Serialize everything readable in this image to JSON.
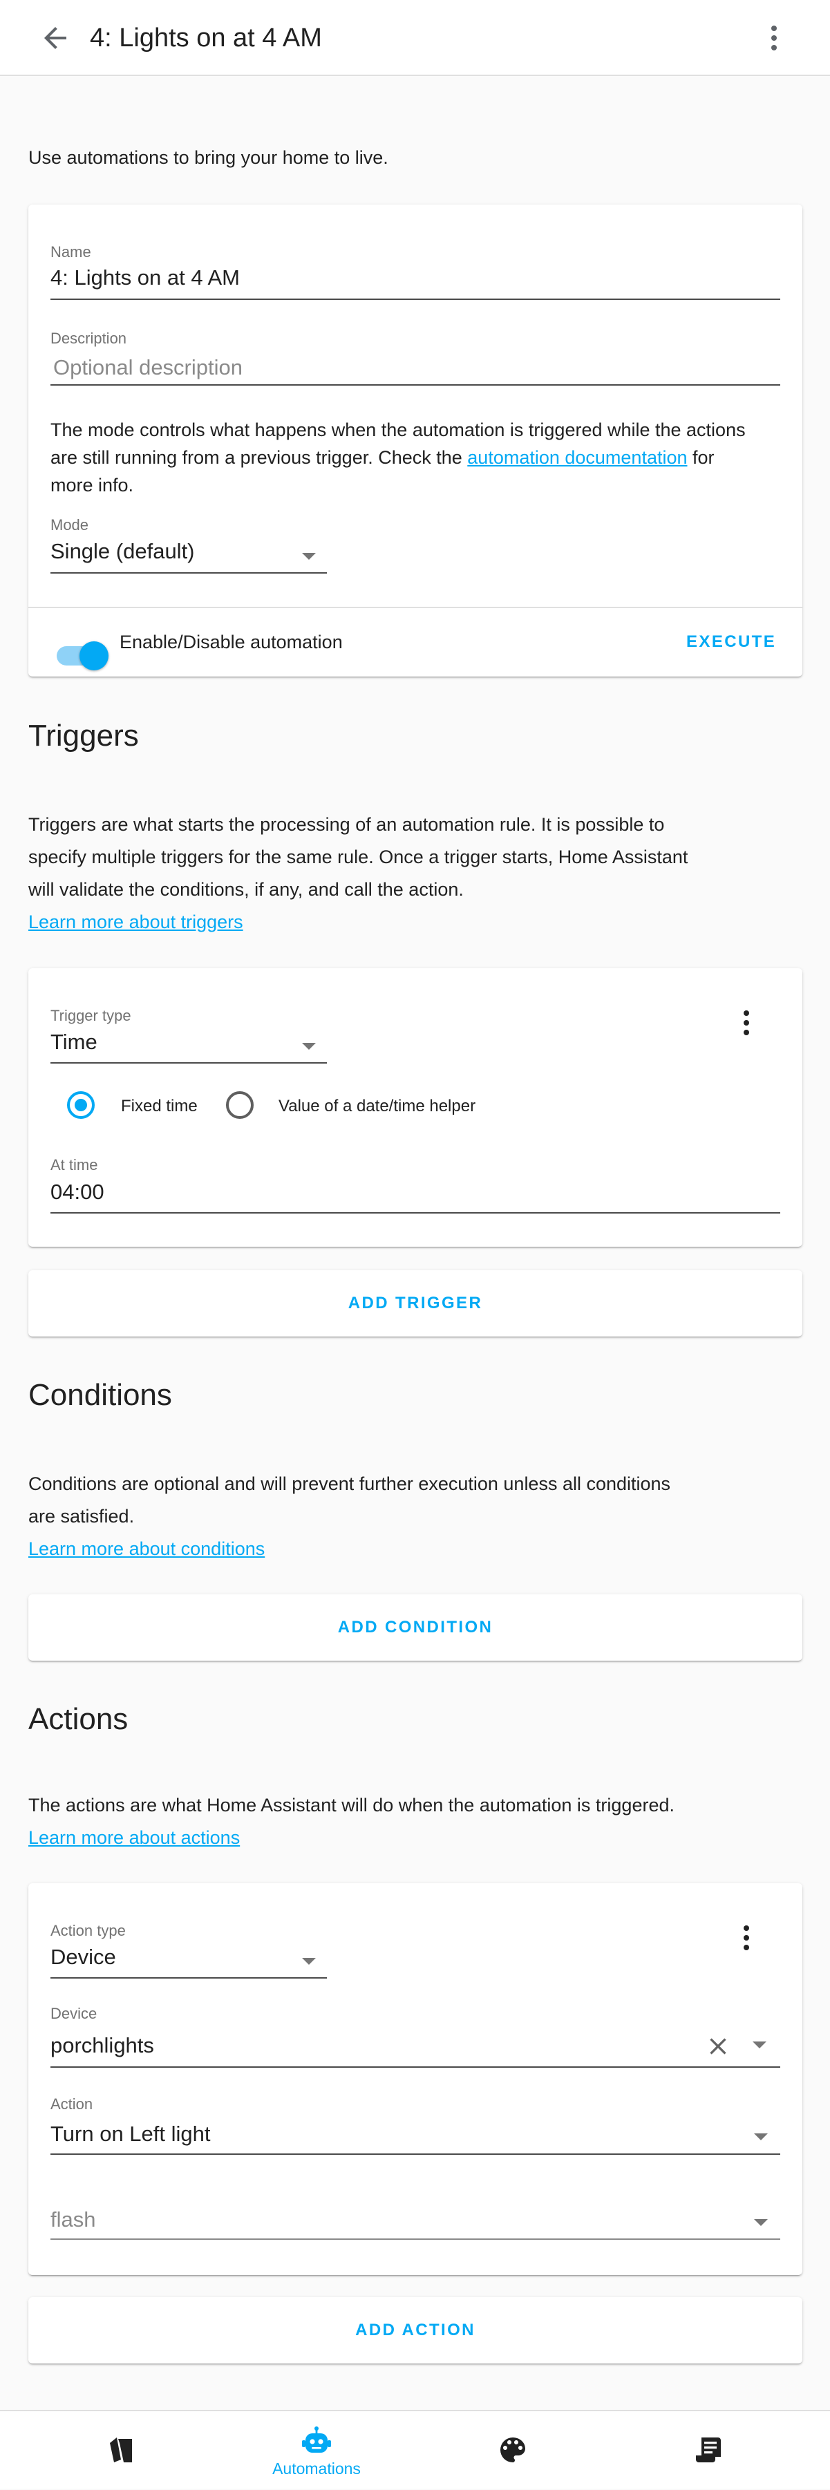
{
  "header": {
    "title": "4: Lights on at 4 AM"
  },
  "intro": "Use automations to bring your home to live.",
  "details": {
    "name_label": "Name",
    "name_value": "4: Lights on at 4 AM",
    "description_label": "Description",
    "description_placeholder": "Optional description",
    "mode_text_1": "The mode controls what happens when the automation is triggered while the actions",
    "mode_text_2a": "are still running from a previous trigger. Check the ",
    "mode_link": "automation documentation",
    "mode_text_2b": " for",
    "mode_text_3": "more info.",
    "mode_label": "Mode",
    "mode_value": "Single (default)",
    "toggle_label": "Enable/Disable automation",
    "toggle_on": true,
    "execute_label": "EXECUTE"
  },
  "triggers": {
    "title": "Triggers",
    "desc_1": "Triggers are what starts the processing of an automation rule. It is possible to",
    "desc_2": "specify multiple triggers for the same rule. Once a trigger starts, Home Assistant",
    "desc_3": "will validate the conditions, if any, and call the action.",
    "learn_more": "Learn more about triggers",
    "type_label": "Trigger type",
    "type_value": "Time",
    "radio_fixed": "Fixed time",
    "radio_helper": "Value of a date/time helper",
    "selected_radio": "Fixed time",
    "at_time_label": "At time",
    "at_time_value": "04:00",
    "add_label": "ADD TRIGGER"
  },
  "conditions": {
    "title": "Conditions",
    "desc_1": "Conditions are optional and will prevent further execution unless all conditions",
    "desc_2": "are satisfied.",
    "learn_more": "Learn more about conditions",
    "add_label": "ADD CONDITION"
  },
  "actions": {
    "title": "Actions",
    "desc_1": "The actions are what Home Assistant will do when the automation is triggered.",
    "learn_more": "Learn more about actions",
    "type_label": "Action type",
    "type_value": "Device",
    "device_label": "Device",
    "device_value": "porchlights",
    "action_label": "Action",
    "action_value": "Turn on Left light",
    "flash_placeholder": "flash",
    "add_label": "ADD ACTION"
  },
  "bottom_nav": {
    "items": [
      {
        "icon": "devices-icon",
        "label": ""
      },
      {
        "icon": "robot-icon",
        "label": "Automations",
        "active": true
      },
      {
        "icon": "palette-icon",
        "label": ""
      },
      {
        "icon": "script-icon",
        "label": ""
      }
    ]
  },
  "colors": {
    "accent": "#03a9f4",
    "text": "#212121",
    "secondary_text": "#727272",
    "background": "#fafafa"
  }
}
